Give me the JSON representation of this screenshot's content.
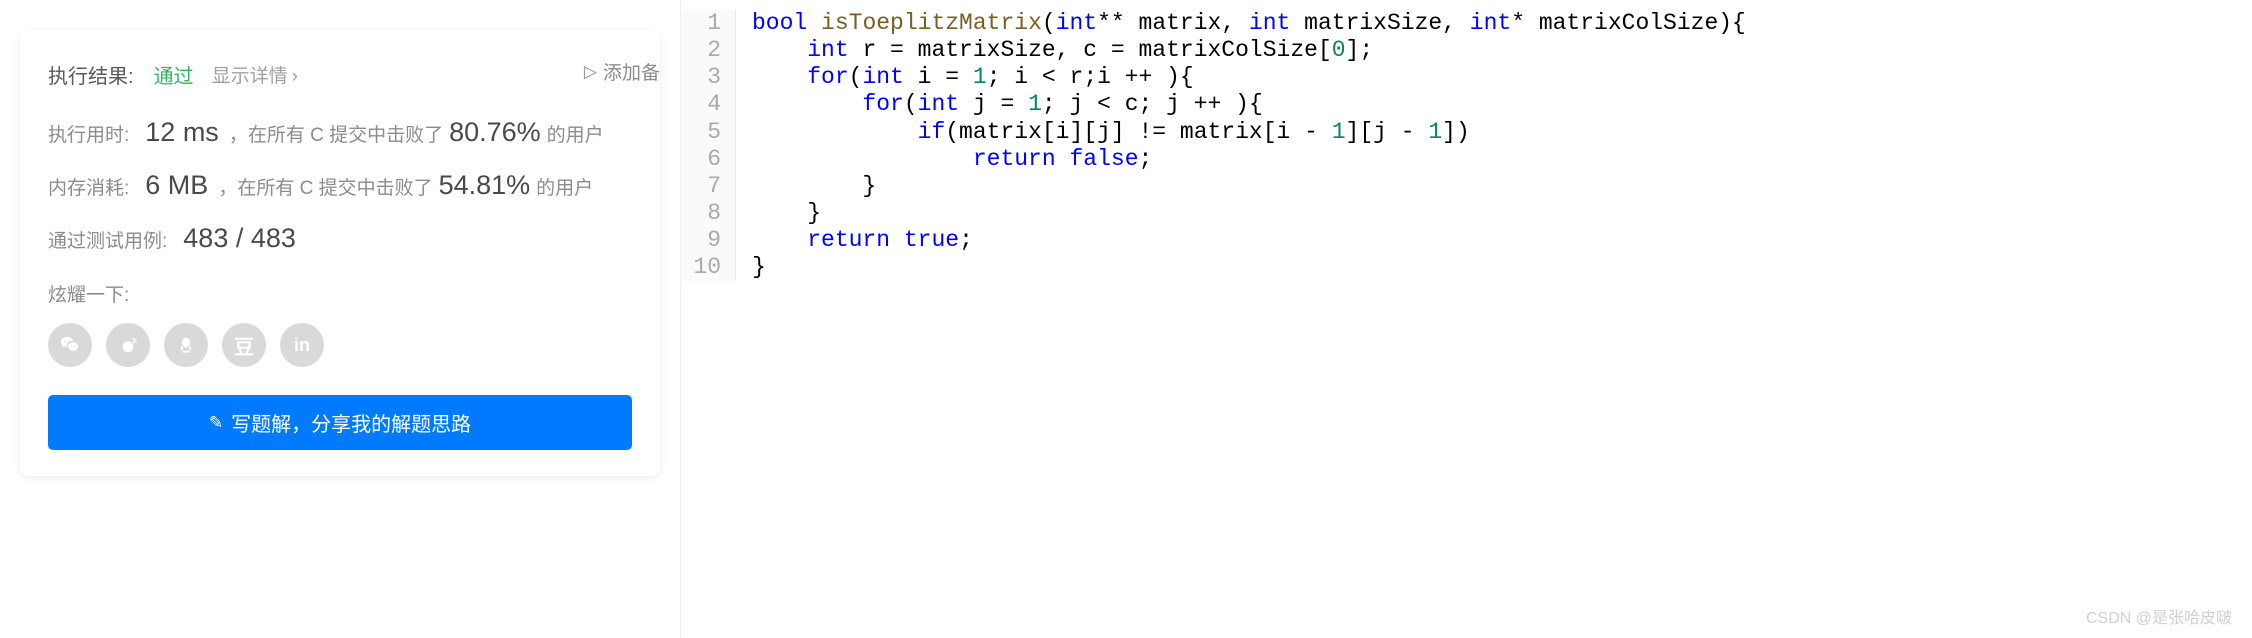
{
  "result": {
    "label": "执行结果:",
    "status": "通过",
    "detail_link": "显示详情",
    "add_note": "添加备"
  },
  "runtime": {
    "label": "执行用时:",
    "value": "12 ms",
    "text1": "，在所有 C 提交中击败了",
    "pct": "80.76%",
    "text2": "的用户"
  },
  "memory": {
    "label": "内存消耗:",
    "value": "6 MB",
    "text1": "，在所有 C 提交中击败了",
    "pct": "54.81%",
    "text2": "的用户"
  },
  "testcases": {
    "label": "通过测试用例:",
    "value": "483 / 483"
  },
  "share": {
    "label": "炫耀一下:"
  },
  "write_btn": "写题解，分享我的解题思路",
  "code": {
    "lines": [
      {
        "n": "1",
        "parts": [
          [
            "kw",
            "bool"
          ],
          [
            "punc",
            " "
          ],
          [
            "func",
            "isToeplitzMatrix"
          ],
          [
            "punc",
            "("
          ],
          [
            "type",
            "int"
          ],
          [
            "punc",
            "** matrix, "
          ],
          [
            "type",
            "int"
          ],
          [
            "punc",
            " matrixSize, "
          ],
          [
            "type",
            "int"
          ],
          [
            "punc",
            "* matrixColSize){"
          ]
        ]
      },
      {
        "n": "2",
        "parts": [
          [
            "punc",
            "    "
          ],
          [
            "type",
            "int"
          ],
          [
            "punc",
            " r = matrixSize, c = matrixColSize["
          ],
          [
            "num",
            "0"
          ],
          [
            "punc",
            "];"
          ]
        ]
      },
      {
        "n": "3",
        "parts": [
          [
            "punc",
            "    "
          ],
          [
            "kw",
            "for"
          ],
          [
            "punc",
            "("
          ],
          [
            "type",
            "int"
          ],
          [
            "punc",
            " i = "
          ],
          [
            "num",
            "1"
          ],
          [
            "punc",
            "; i < r;i ++ ){"
          ]
        ]
      },
      {
        "n": "4",
        "parts": [
          [
            "punc",
            "        "
          ],
          [
            "kw",
            "for"
          ],
          [
            "punc",
            "("
          ],
          [
            "type",
            "int"
          ],
          [
            "punc",
            " j = "
          ],
          [
            "num",
            "1"
          ],
          [
            "punc",
            "; j < c; j ++ ){"
          ]
        ]
      },
      {
        "n": "5",
        "parts": [
          [
            "punc",
            "            "
          ],
          [
            "kw",
            "if"
          ],
          [
            "punc",
            "(matrix[i][j] != matrix[i - "
          ],
          [
            "num",
            "1"
          ],
          [
            "punc",
            "][j - "
          ],
          [
            "num",
            "1"
          ],
          [
            "punc",
            "])"
          ]
        ]
      },
      {
        "n": "6",
        "parts": [
          [
            "punc",
            "                "
          ],
          [
            "kw",
            "return"
          ],
          [
            "punc",
            " "
          ],
          [
            "bool",
            "false"
          ],
          [
            "punc",
            ";"
          ]
        ]
      },
      {
        "n": "7",
        "parts": [
          [
            "punc",
            "        }"
          ]
        ]
      },
      {
        "n": "8",
        "parts": [
          [
            "punc",
            "    }"
          ]
        ]
      },
      {
        "n": "9",
        "parts": [
          [
            "punc",
            "    "
          ],
          [
            "kw",
            "return"
          ],
          [
            "punc",
            " "
          ],
          [
            "bool",
            "true"
          ],
          [
            "punc",
            ";"
          ]
        ]
      },
      {
        "n": "10",
        "parts": [
          [
            "punc",
            "}"
          ]
        ]
      }
    ]
  },
  "watermark": "CSDN @是张哈皮啵"
}
